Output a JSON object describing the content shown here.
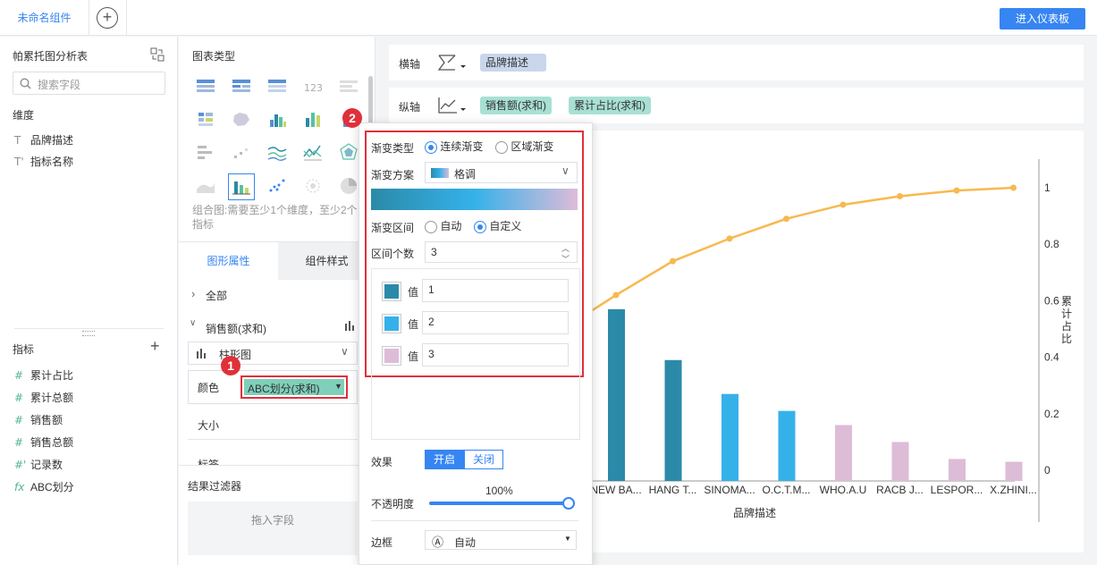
{
  "topbar": {
    "tab_label": "未命名组件",
    "add_label": "+",
    "enter_button": "进入仪表板"
  },
  "left": {
    "table_name": "帕累托图分析表",
    "search_placeholder": "搜索字段",
    "dimension_title": "维度",
    "dimensions": [
      {
        "icon": "T",
        "label": "品牌描述"
      },
      {
        "icon": "T'",
        "label": "指标名称"
      }
    ],
    "metric_title": "指标",
    "metrics": [
      {
        "icon": "#",
        "label": "累计占比"
      },
      {
        "icon": "#",
        "label": "累计总额"
      },
      {
        "icon": "#",
        "label": "销售额"
      },
      {
        "icon": "#",
        "label": "销售总额"
      },
      {
        "icon": "#'",
        "label": "记录数"
      },
      {
        "icon": "fx",
        "label": "ABC划分"
      }
    ]
  },
  "middle": {
    "chart_type_title": "图表类型",
    "combo_hint": "组合图:需要至少1个维度，至少2个指标",
    "tab_graphic": "图形属性",
    "tab_style": "组件样式",
    "all_label": "全部",
    "measure_label": "销售额(求和)",
    "chart_kind": "柱形图",
    "color_label": "颜色",
    "color_field": "ABC划分(求和)",
    "size_label": "大小",
    "tag_label": "标签",
    "filter_title": "结果过滤器",
    "drop_hint": "拖入字段",
    "badge1": "1",
    "badge2": "2"
  },
  "axes": {
    "x_label": "横轴",
    "x_field": "品牌描述",
    "y_label": "纵轴",
    "y_field1": "销售额(求和)",
    "y_field2": "累计占比(求和)"
  },
  "popup": {
    "gradient_type_label": "渐变类型",
    "opt_continuous": "连续渐变",
    "opt_region": "区域渐变",
    "scheme_label": "渐变方案",
    "scheme_value": "格调",
    "interval_label": "渐变区间",
    "opt_auto": "自动",
    "opt_custom": "自定义",
    "count_label": "区间个数",
    "count_value": "3",
    "value_label": "值",
    "values": [
      "1",
      "2",
      "3"
    ],
    "effect_label": "效果",
    "effect_on": "开启",
    "effect_off": "关闭",
    "opacity_label": "不透明度",
    "opacity_value": "100%",
    "border_label": "边框",
    "border_icon": "Ⓐ",
    "border_value": "自动"
  },
  "colors": {
    "accent": "#3685f2",
    "band1": "#2b8aa8",
    "band2": "#35b1ea",
    "band3": "#ddbcd8",
    "line": "#f7b94f"
  },
  "chart_data": {
    "type": "bar",
    "xlabel": "品牌描述",
    "ylabel_right": "累计占比",
    "categories": [
      "NEW BA...",
      "HANG T...",
      "SINOMA...",
      "O.C.T.M...",
      "WHO.A.U",
      "RACB J...",
      "LESPOR...",
      "X.ZHINI..."
    ],
    "bar_values": [
      0.57,
      0.39,
      0.27,
      0.21,
      0.16,
      0.1,
      0.04,
      0.03
    ],
    "bar_bands": [
      1,
      1,
      2,
      2,
      3,
      3,
      3,
      3
    ],
    "line_values": [
      0.62,
      0.74,
      0.82,
      0.89,
      0.94,
      0.97,
      0.99,
      1.0
    ],
    "right_ticks": [
      "1",
      "0.8",
      "0.6",
      "0.4",
      "0.2",
      "0"
    ],
    "ylim": [
      0,
      1
    ]
  }
}
